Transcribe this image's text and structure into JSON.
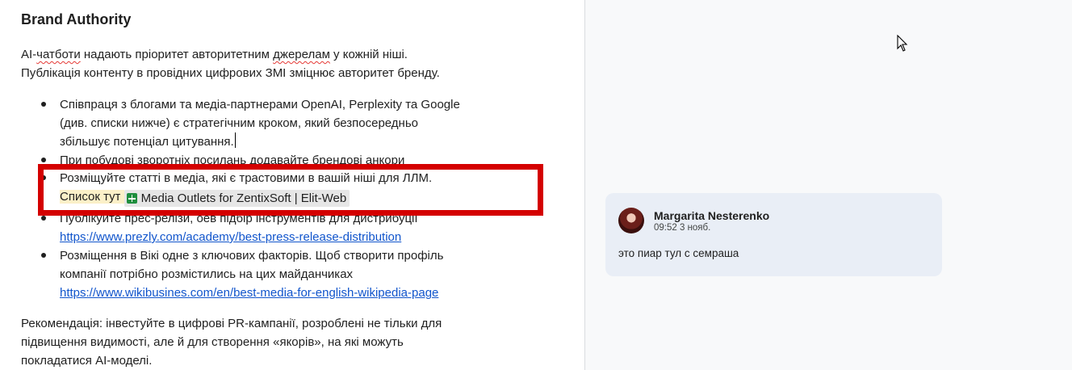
{
  "document": {
    "heading": "Brand Authority",
    "intro": {
      "p1_prefix": "AI-",
      "p1_word1": "чатботи",
      "p1_mid": " надають пріоритет авторитетним ",
      "p1_word2": "джерелам",
      "p1_suffix": " у кожній ніші.",
      "p1_line2": "Публікація контенту в провідних цифрових ЗМІ зміцнює авторитет бренду."
    },
    "items": [
      {
        "line1": "Співпраця з блогами та медіа-партнерами OpenAI, Perplexity та Google",
        "line2": "(див. списки нижче) є стратегічним кроком, який безпосередньо",
        "line3": "збільшує потенціал цитування."
      },
      {
        "line1": "При побудові зворотніх посилань додавайте брендові анкори"
      },
      {
        "line1": "Розміщуйте статті в медіа, які є трастовими в вашій ніші для ЛЛМ.",
        "highlight_label": "Список тут",
        "chip_label": "Media Outlets for ZentixSoft | Elit-Web"
      },
      {
        "line1": "Публікуйте прес-релізи, оев підбір інструментів для дистрибуції",
        "link": "https://www.prezly.com/academy/best-press-release-distribution"
      },
      {
        "line1": "Розміщення в Вікі одне з ключових факторів. Щоб створити профіль",
        "line2": "компанії потрібно розмістились на цих майданчиках",
        "link": "https://www.wikibusines.com/en/best-media-for-english-wikipedia-page"
      }
    ],
    "recommendation": {
      "line1": "Рекомендація: інвестуйте в цифрові PR-кампанії, розроблені не тільки для",
      "line2": "підвищення видимості, але й для створення «якорів», на які можуть",
      "line3": "покладатися AI-моделі."
    }
  },
  "comment": {
    "author": "Margarita Nesterenko",
    "time": "09:52 3 нояб.",
    "text": "это пиар тул с семраша"
  },
  "icons": {
    "chip_icon": "google-sheets-icon",
    "cursor": "mouse-pointer-icon"
  },
  "colors": {
    "link": "#1155cc",
    "highlight_box": "#d40000",
    "comment_bg": "#e9eef6",
    "text_highlight": "#fbf0c8",
    "chip_bg": "#e6e6e6"
  }
}
